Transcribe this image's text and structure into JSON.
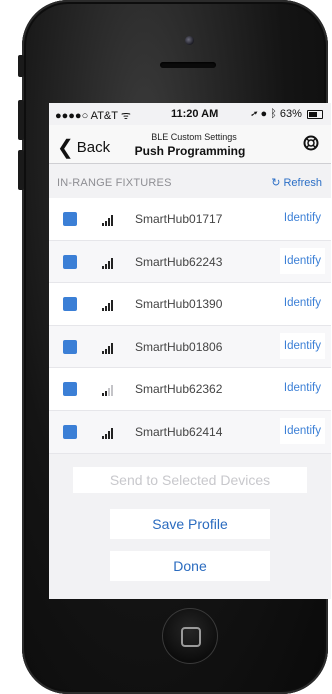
{
  "status_bar": {
    "carrier": "●●●●○ AT&T ᯤ",
    "time": "11:20 AM",
    "right": "➚ ● ᛒ 63%"
  },
  "nav": {
    "back_label": "Back",
    "subtitle": "BLE Custom Settings",
    "title": "Push Programming",
    "help_icon": "lifebuoy-icon"
  },
  "section": {
    "header": "IN-RANGE FIXTURES",
    "refresh_label": "Refresh"
  },
  "devices": [
    {
      "name": "SmartHub01717",
      "identify": "Identify",
      "signal_bars": 4
    },
    {
      "name": "SmartHub62243",
      "identify": "Identify",
      "signal_bars": 4
    },
    {
      "name": "SmartHub01390",
      "identify": "Identify",
      "signal_bars": 4
    },
    {
      "name": "SmartHub01806",
      "identify": "Identify",
      "signal_bars": 4
    },
    {
      "name": "SmartHub62362",
      "identify": "Identify",
      "signal_bars": 2
    },
    {
      "name": "SmartHub62414",
      "identify": "Identify",
      "signal_bars": 4
    }
  ],
  "actions": {
    "send_label": "Send to Selected Devices",
    "save_label": "Save Profile",
    "done_label": "Done"
  },
  "colors": {
    "accent": "#3b7fd6",
    "button_text": "#2a6bbf",
    "disabled_text": "#c8c8cc"
  }
}
